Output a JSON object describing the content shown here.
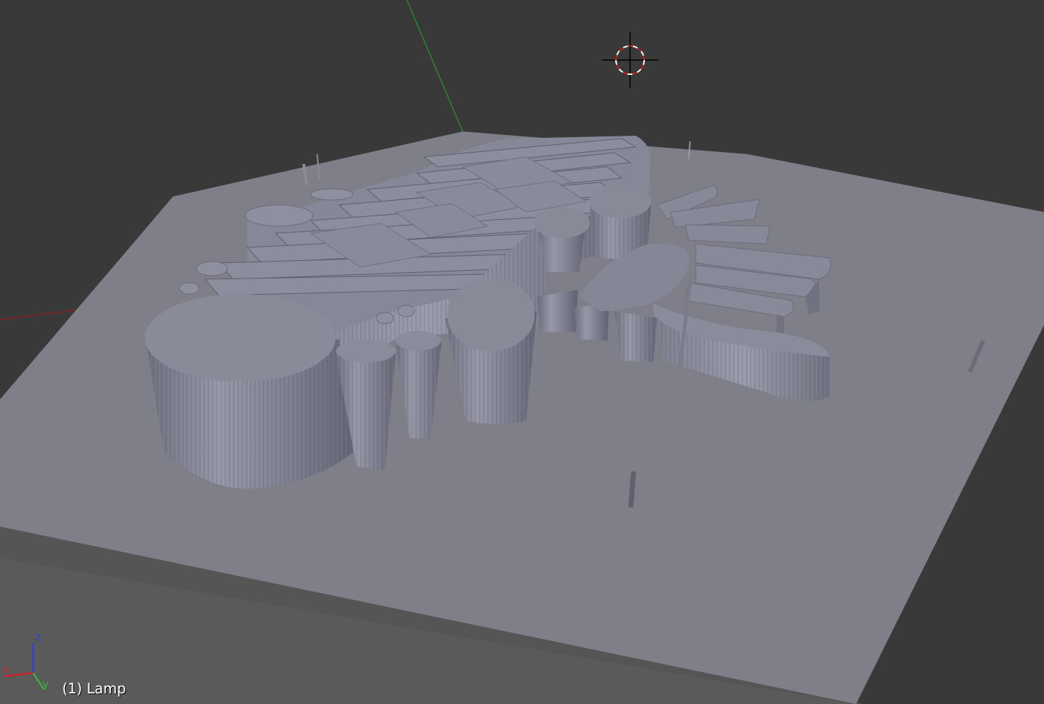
{
  "viewport": {
    "object_label": "(1) Lamp",
    "background_color": "#393939"
  },
  "axis_gizmo": {
    "x_label": "x",
    "y_label": "y",
    "z_label": "z",
    "x_color": "#d0202a",
    "y_color": "#3bb33b",
    "z_color": "#2f3fd8"
  },
  "grid_axes": {
    "x_axis_color": "#8a1f1f",
    "y_axis_color": "#2a8a2a"
  },
  "model": {
    "base_top_color": "#7f7f8a",
    "base_side_color": "#5a5a5a",
    "relief_color": "#868897",
    "relief_shadow_color": "#6e7080"
  },
  "icons": {
    "cursor": "3d-cursor-icon"
  }
}
